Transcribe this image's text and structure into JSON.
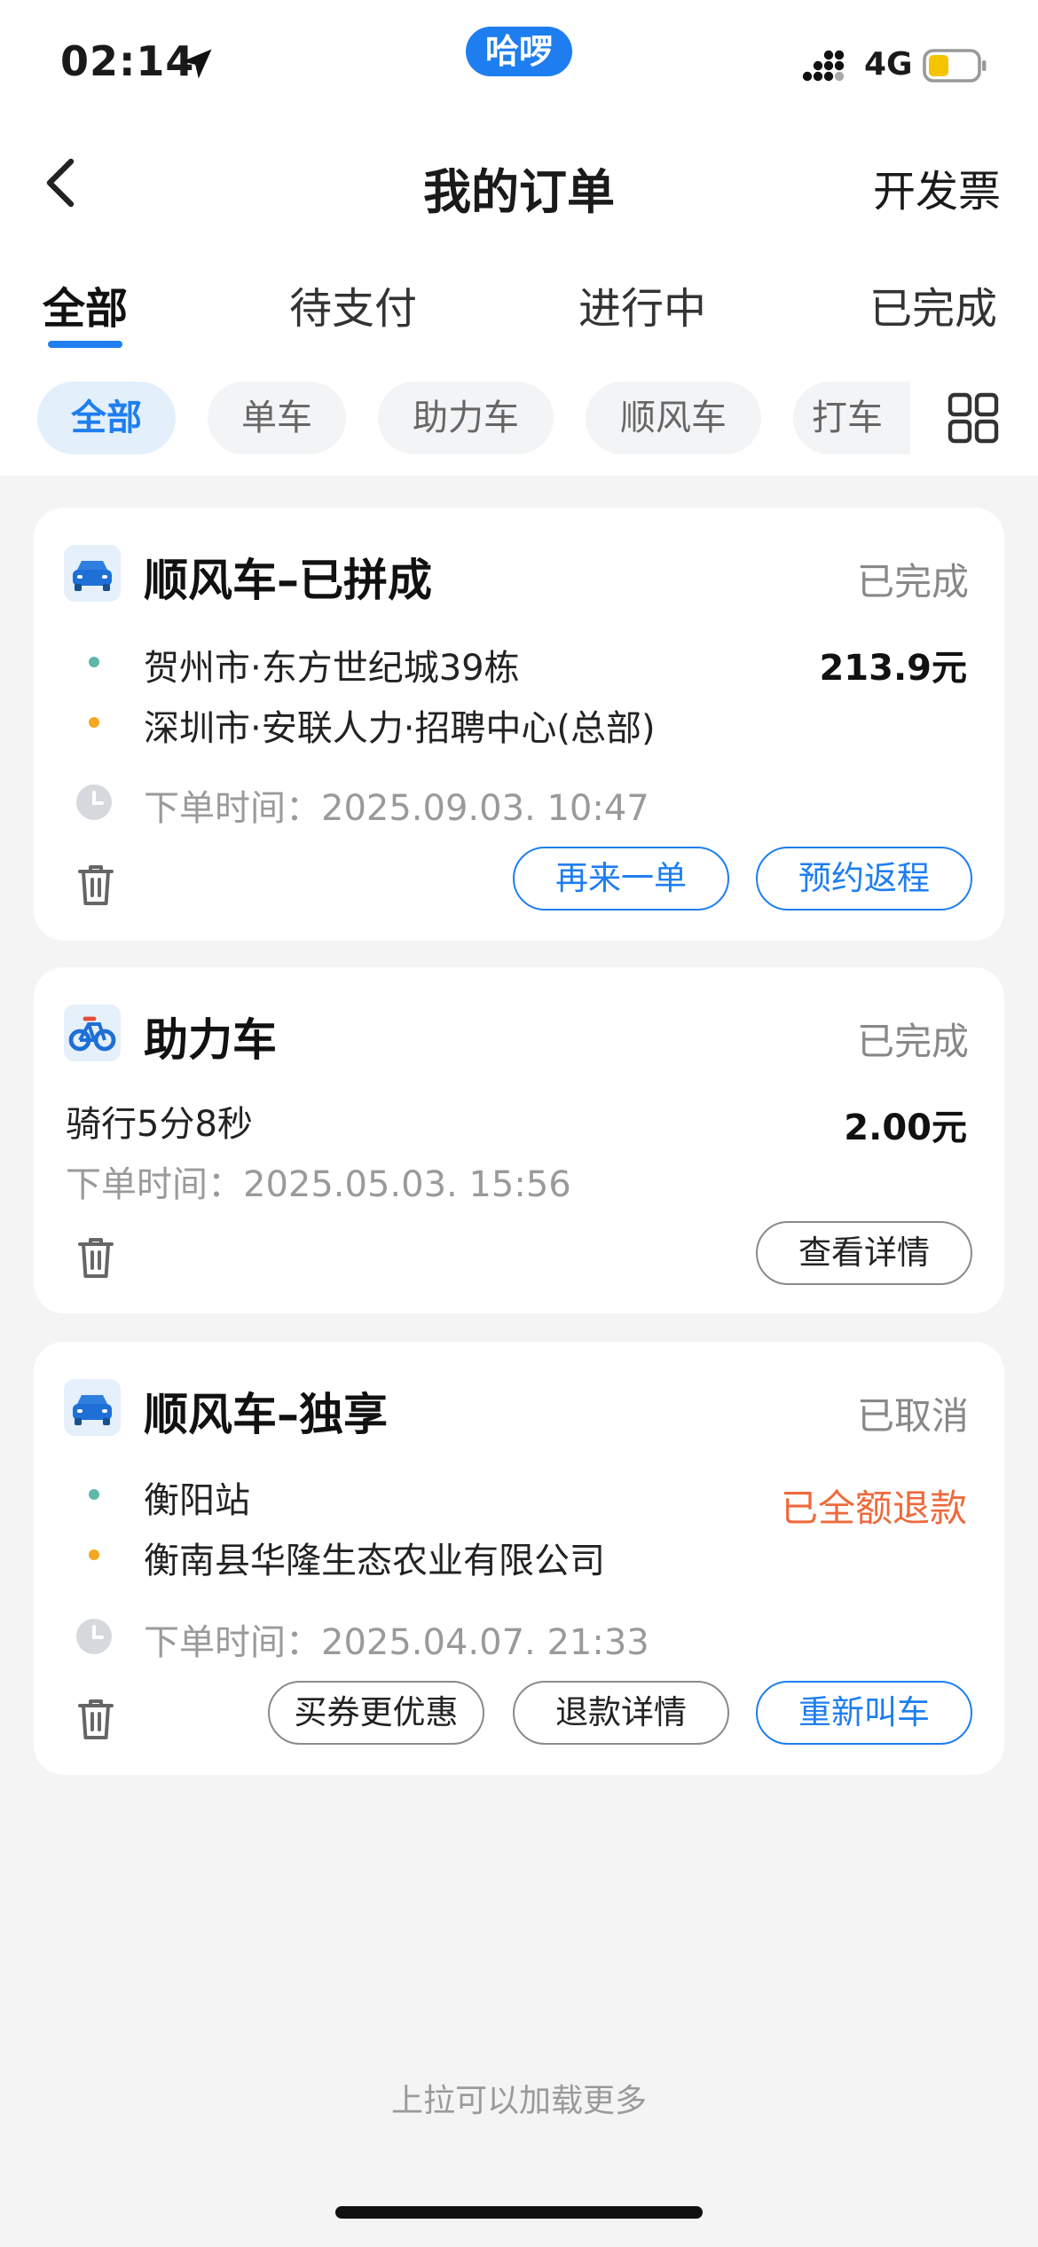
{
  "status_bar": {
    "time": "02:14",
    "app_pill": "哈啰",
    "network": "4G",
    "battery_color": "#f5c400"
  },
  "nav": {
    "title": "我的订单",
    "right_action": "开发票"
  },
  "tabs": [
    {
      "label": "全部",
      "active": true
    },
    {
      "label": "待支付",
      "active": false
    },
    {
      "label": "进行中",
      "active": false
    },
    {
      "label": "已完成",
      "active": false
    }
  ],
  "chips": [
    {
      "label": "全部",
      "active": true
    },
    {
      "label": "单车",
      "active": false
    },
    {
      "label": "助力车",
      "active": false
    },
    {
      "label": "顺风车",
      "active": false
    },
    {
      "label": "打车",
      "active": false
    }
  ],
  "orders": [
    {
      "icon": "car-icon",
      "title": "顺风车–已拼成",
      "status": "已完成",
      "from": "贺州市·东方世纪城39栋",
      "to": "深圳市·安联人力·招聘中心(总部)",
      "price": "213.9元",
      "time_label": "下单时间：",
      "time_value": "2025.09.03. 10:47",
      "buttons": [
        "再来一单",
        "预约返程"
      ]
    },
    {
      "icon": "bike-icon",
      "title": "助力车",
      "status": "已完成",
      "ride_desc": "骑行5分8秒",
      "price": "2.00元",
      "time_label": "下单时间：",
      "time_value": "2025.05.03. 15:56",
      "buttons": [
        "查看详情"
      ]
    },
    {
      "icon": "car-icon",
      "title": "顺风车–独享",
      "status": "已取消",
      "from": "衡阳站",
      "to": "衡南县华隆生态农业有限公司",
      "refund": "已全额退款",
      "time_label": "下单时间：",
      "time_value": "2025.04.07. 21:33",
      "buttons": [
        "买券更优惠",
        "退款详情",
        "重新叫车"
      ]
    }
  ],
  "footer": {
    "load_more": "上拉可以加载更多"
  },
  "colors": {
    "accent": "#1e7ef0",
    "refund": "#ef6a3c",
    "page_bg": "#f4f4f5"
  }
}
